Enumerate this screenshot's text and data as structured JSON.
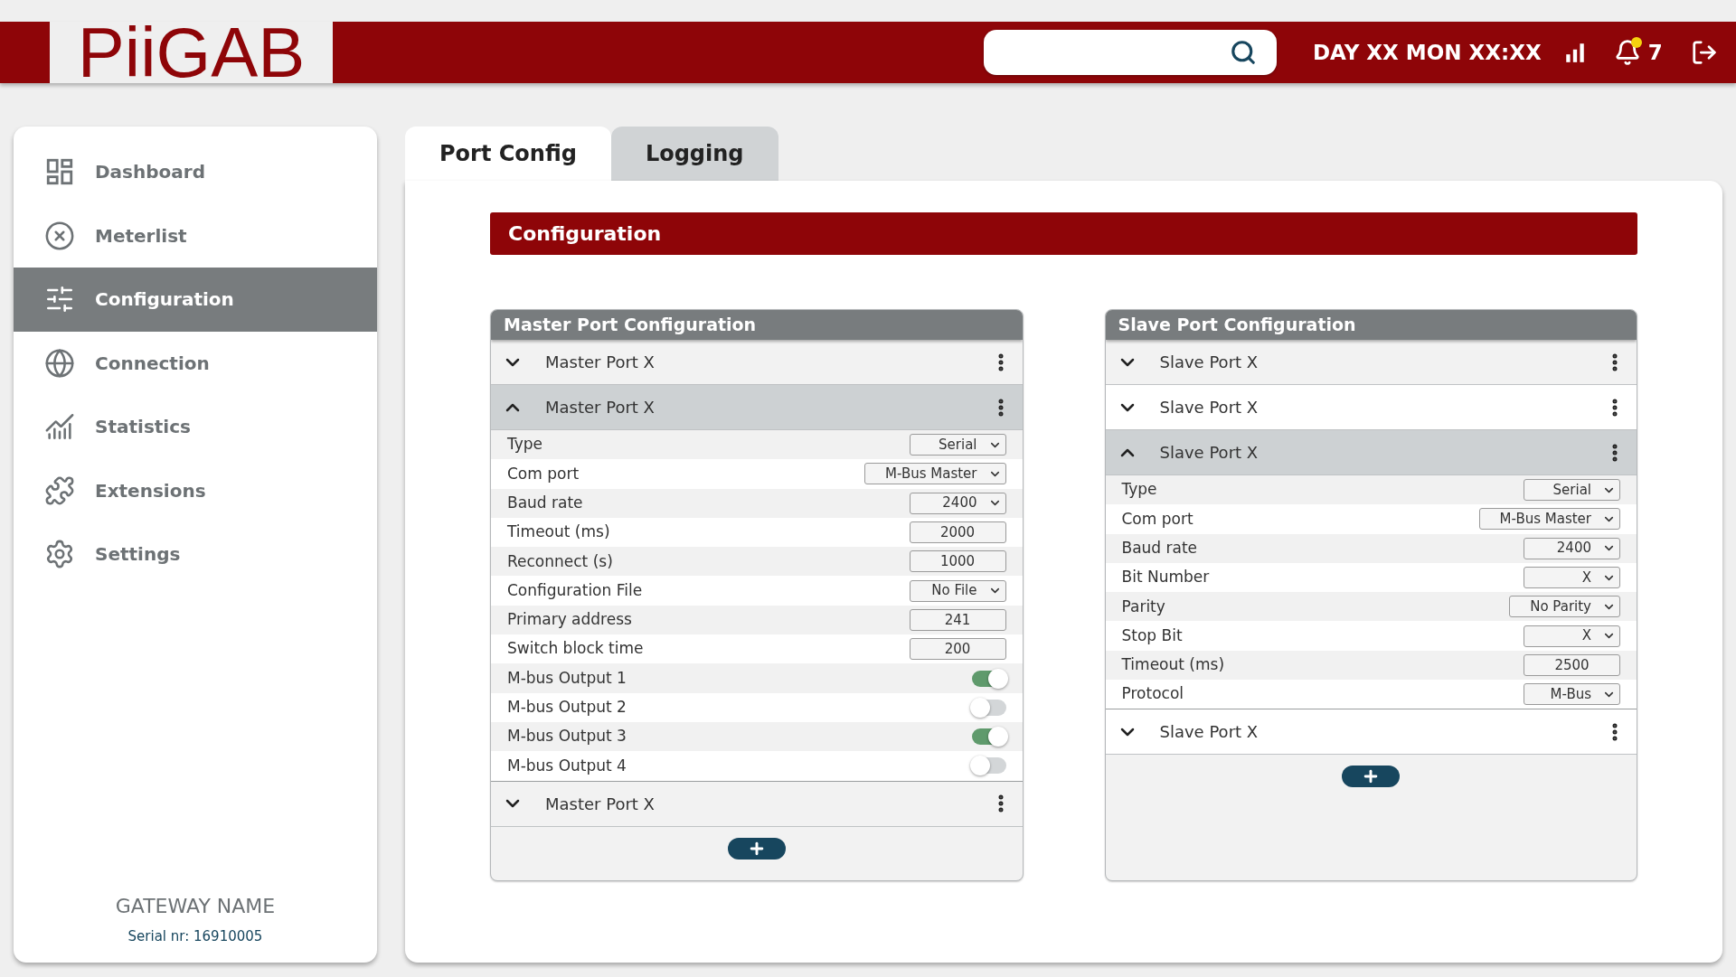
{
  "header": {
    "logo": "PiiGAB",
    "datetime": "DAY XX MON XX:XX",
    "notification_count": "7"
  },
  "sidebar": {
    "items": [
      {
        "label": "Dashboard",
        "selected": false
      },
      {
        "label": "Meterlist",
        "selected": false
      },
      {
        "label": "Configuration",
        "selected": true
      },
      {
        "label": "Connection",
        "selected": false
      },
      {
        "label": "Statistics",
        "selected": false
      },
      {
        "label": "Extensions",
        "selected": false
      },
      {
        "label": "Settings",
        "selected": false
      }
    ],
    "gateway_name": "GATEWAY NAME",
    "serial": "Serial nr: 16910005"
  },
  "tabs": [
    {
      "label": "Port Config",
      "selected": true
    },
    {
      "label": "Logging",
      "selected": false
    }
  ],
  "section_title": "Configuration",
  "panels": [
    {
      "title": "Master Port Configuration",
      "ports": [
        {
          "label": "Master Port X",
          "expanded": false
        },
        {
          "label": "Master Port X",
          "expanded": true,
          "fields": [
            {
              "label": "Type",
              "kind": "select",
              "value": "Serial"
            },
            {
              "label": "Com port",
              "kind": "select",
              "value": "M-Bus Master"
            },
            {
              "label": "Baud rate",
              "kind": "select",
              "value": "2400"
            },
            {
              "label": "Timeout (ms)",
              "kind": "input",
              "value": "2000"
            },
            {
              "label": "Reconnect (s)",
              "kind": "input",
              "value": "1000"
            },
            {
              "label": "Configuration File",
              "kind": "select",
              "value": "No File"
            },
            {
              "label": "Primary address",
              "kind": "input",
              "value": "241"
            },
            {
              "label": "Switch block time",
              "kind": "input",
              "value": "200"
            },
            {
              "label": "M-bus Output 1",
              "kind": "toggle",
              "on": true
            },
            {
              "label": "M-bus Output 2",
              "kind": "toggle",
              "on": false
            },
            {
              "label": "M-bus Output 3",
              "kind": "toggle",
              "on": true
            },
            {
              "label": "M-bus Output 4",
              "kind": "toggle",
              "on": false
            }
          ]
        },
        {
          "label": "Master Port X",
          "expanded": false
        }
      ]
    },
    {
      "title": "Slave Port Configuration",
      "ports": [
        {
          "label": "Slave Port X",
          "expanded": false
        },
        {
          "label": "Slave Port X",
          "expanded": false
        },
        {
          "label": "Slave Port X",
          "expanded": true,
          "fields": [
            {
              "label": "Type",
              "kind": "select",
              "value": "Serial"
            },
            {
              "label": "Com port",
              "kind": "select",
              "value": "M-Bus Master"
            },
            {
              "label": "Baud rate",
              "kind": "select",
              "value": "2400"
            },
            {
              "label": "Bit Number",
              "kind": "select",
              "value": "X"
            },
            {
              "label": "Parity",
              "kind": "select",
              "value": "No Parity"
            },
            {
              "label": "Stop Bit",
              "kind": "select",
              "value": "X"
            },
            {
              "label": "Timeout (ms)",
              "kind": "input",
              "value": "2500"
            },
            {
              "label": "Protocol",
              "kind": "select",
              "value": "M-Bus"
            }
          ]
        },
        {
          "label": "Slave Port X",
          "expanded": false
        }
      ]
    }
  ]
}
